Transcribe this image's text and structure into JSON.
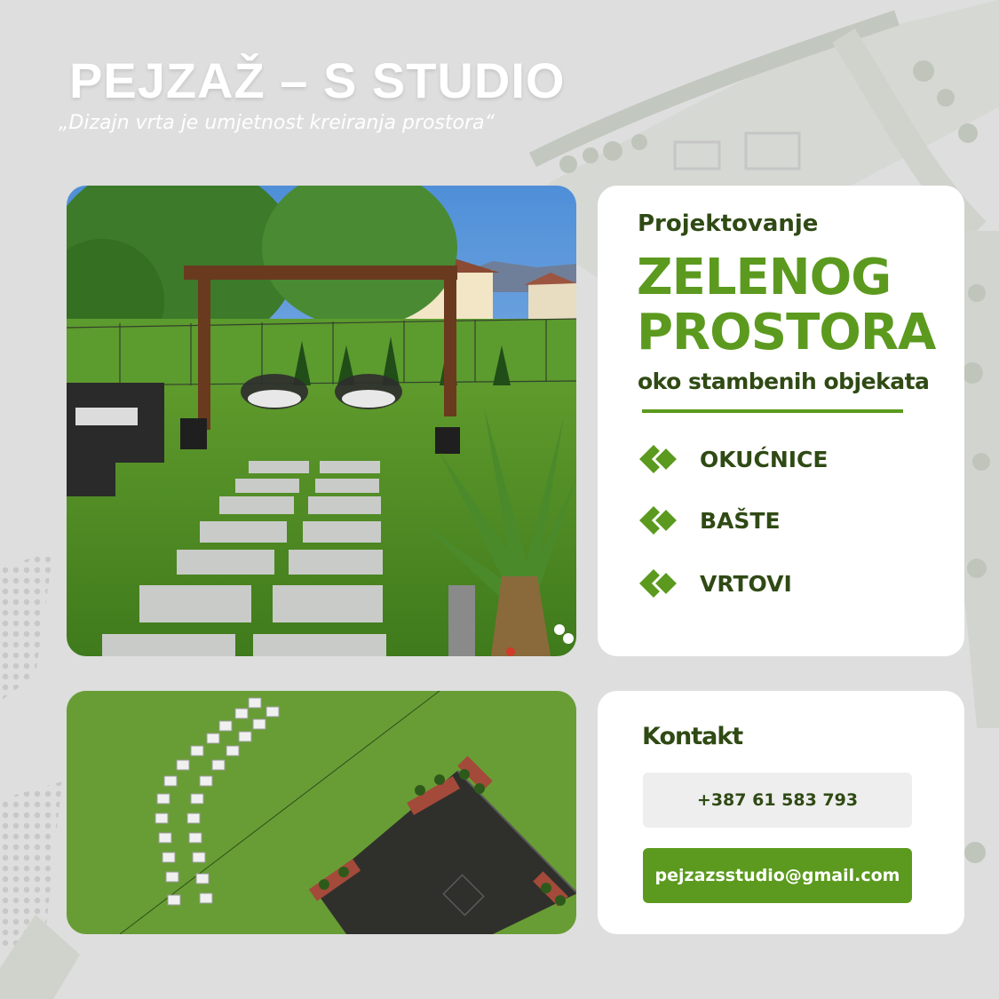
{
  "brand": {
    "title": "PEJZAŽ – S STUDIO",
    "tagline": "„Dizajn vrta je umjetnost kreiranja prostora“"
  },
  "services_card": {
    "lead": "Projektovanje",
    "headline_line1": "ZELENOG",
    "headline_line2": "PROSTORA",
    "subline": "oko stambenih objekata",
    "items": [
      {
        "label": "OKUĆNICE",
        "icon": "double-diamond-icon"
      },
      {
        "label": "BAŠTE",
        "icon": "double-diamond-icon"
      },
      {
        "label": "VRTOVI",
        "icon": "double-diamond-icon"
      }
    ]
  },
  "contact_card": {
    "title": "Kontakt",
    "phone": "+387 61 583 793",
    "email": "pejzazsstudio@gmail.com"
  },
  "colors": {
    "accent_green": "#5b9a1e",
    "dark_green": "#2f4a14",
    "background": "#dcdcdc",
    "card": "#ffffff"
  }
}
